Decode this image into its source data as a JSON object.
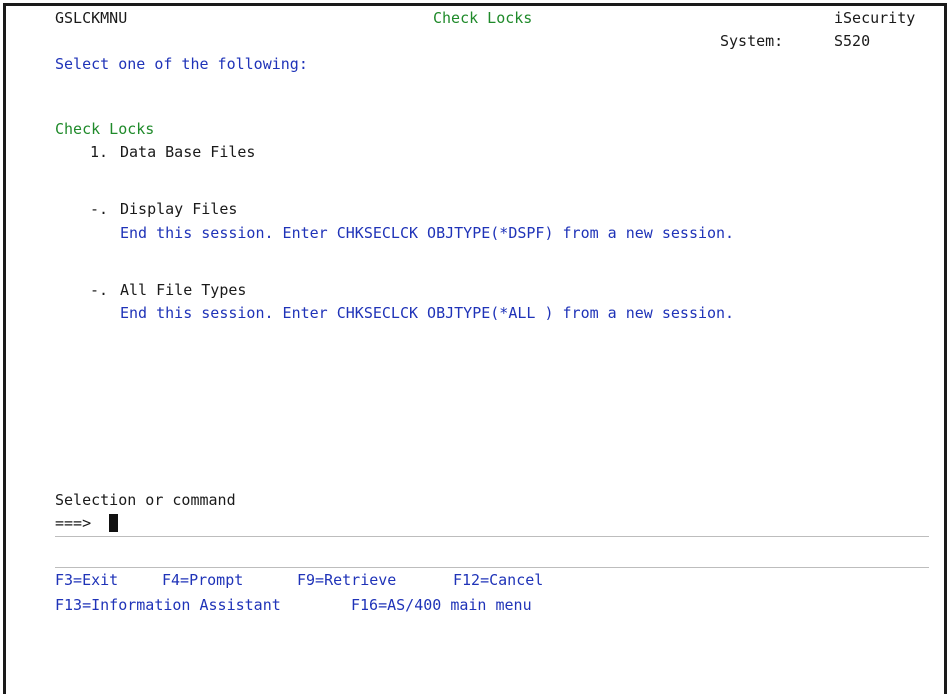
{
  "header": {
    "menu_id": "GSLCKMNU",
    "title": "Check Locks",
    "product": "iSecurity",
    "system_label": "System:",
    "system_value": "S520"
  },
  "instruction": "Select one of the following:",
  "section_title": "Check Locks",
  "options": [
    {
      "number": "1.",
      "label": "Data Base Files"
    },
    {
      "number": "-.",
      "label": "Display Files",
      "note": "End this session. Enter CHKSECLCK OBJTYPE(*DSPF) from a new session."
    },
    {
      "number": "-.",
      "label": "All File Types",
      "note": "End this session. Enter CHKSECLCK OBJTYPE(*ALL ) from a new session."
    }
  ],
  "command": {
    "label": "Selection or command",
    "prompt": "===>",
    "value": ""
  },
  "function_keys": [
    "F3=Exit",
    "F4=Prompt",
    "F9=Retrieve",
    "F12=Cancel",
    "F13=Information Assistant",
    "F16=AS/400 main menu"
  ]
}
